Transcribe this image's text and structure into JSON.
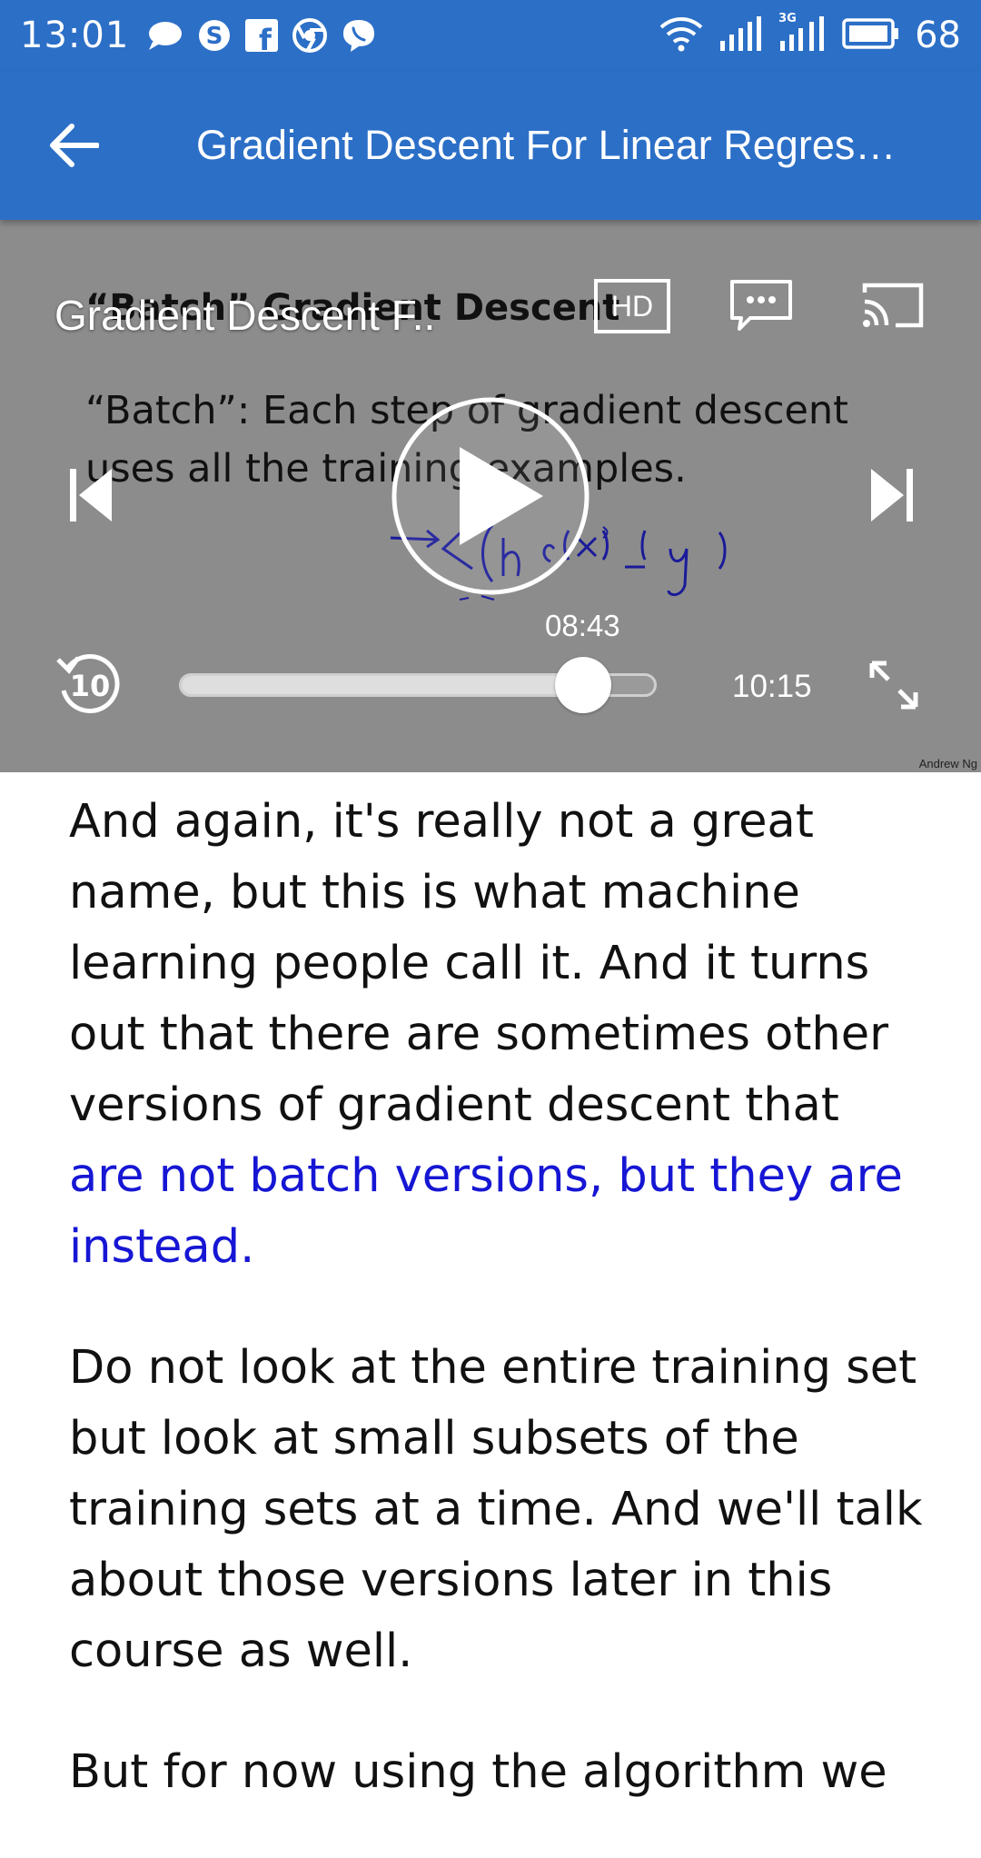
{
  "status_bar": {
    "time": "13:01",
    "battery": "68",
    "left_icons": [
      "chat-bubble-icon",
      "skype-icon",
      "facebook-icon",
      "chrome-icon",
      "viber-icon"
    ],
    "right_icons": [
      "wifi-icon",
      "signal-icon",
      "signal-3g-icon",
      "battery-icon"
    ],
    "network_label": "3G"
  },
  "app_bar": {
    "title": "Gradient Descent For Linear Regres…",
    "color": "#2c6fc7"
  },
  "player": {
    "overlay_title": "Gradient Descent F..",
    "hd_label": "HD",
    "current_time": "08:43",
    "total_time": "10:15",
    "rewind_label": "10",
    "progress": 0.85,
    "slide": {
      "title": "“Batch” Gradient Descent",
      "body": "“Batch”: Each step of gradient descent uses all the training examples.",
      "credit": "Andrew Ng"
    }
  },
  "transcript": {
    "p1_plain": "And again, it's really not a great name, but this is what machine learning people call it. And it turns out that there are sometimes other versions of gradient descent that ",
    "p1_highlight": "are not batch versions, but they are instead.",
    "p2": "Do not look at the entire training set but look at small subsets of the training sets at a time. And we'll talk about those versions later in this course as well.",
    "p3": "But for now using the algorithm we",
    "highlight_color": "#1616d4"
  }
}
